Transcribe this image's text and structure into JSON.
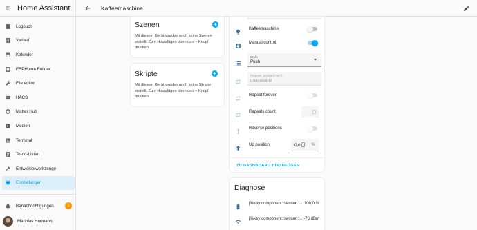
{
  "app": {
    "title": "Home Assistant"
  },
  "sidebar": {
    "items": [
      {
        "label": "Logbuch",
        "icon": "logbook-icon"
      },
      {
        "label": "Verlauf",
        "icon": "history-icon"
      },
      {
        "label": "Kalender",
        "icon": "calendar-icon"
      },
      {
        "label": "ESPHome Builder",
        "icon": "esphome-icon"
      },
      {
        "label": "File editor",
        "icon": "wrench-icon"
      },
      {
        "label": "HACS",
        "icon": "hacs-icon"
      },
      {
        "label": "Matter Hub",
        "icon": "matter-icon"
      },
      {
        "label": "Medien",
        "icon": "media-icon"
      },
      {
        "label": "Terminal",
        "icon": "terminal-icon"
      },
      {
        "label": "To-do-Listen",
        "icon": "todo-icon"
      },
      {
        "label": "Entwicklerwerkzeuge",
        "icon": "hammer-icon"
      },
      {
        "label": "Einstellungen",
        "icon": "gear-icon",
        "active": true
      }
    ],
    "notifications": {
      "label": "Benachrichtigungen",
      "count": "1"
    },
    "user": {
      "name": "Matthias Hormann"
    }
  },
  "header": {
    "title": "Kaffeemaschine"
  },
  "scenes_card": {
    "title": "Szenen",
    "text": "Mit diesem Gerät wurden noch keine Szenen erstellt. Zum Hinzufügen oben den + Knopf drücken."
  },
  "scripts_card": {
    "title": "Skripte",
    "text": "Mit diesem Gerät wurden noch keine Skripte erstellt. Zum Hinzufügen oben den + Knopf drücken."
  },
  "controls": {
    "kaffeemaschine": {
      "label": "Kaffeemaschine",
      "state": "off"
    },
    "manual_control": {
      "label": "Manual control",
      "state": "on"
    },
    "mode": {
      "label": "Mode",
      "value": "Push"
    },
    "program": {
      "label": "Program_position[\"mm\"]...",
      "value": "unavailable"
    },
    "repeat_forever": {
      "label": "Repeat forever",
      "state": "off"
    },
    "repeats_count": {
      "label": "Repeats count"
    },
    "reverse_positions": {
      "label": "Reverse positions",
      "state": "off"
    },
    "up_position": {
      "label": "Up position",
      "value": "0.0",
      "unit": "%"
    },
    "add_to_dashboard": "ZU DASHBOARD HINZUFÜGEN"
  },
  "diagnose": {
    "title": "Diagnose",
    "rows": [
      {
        "label": "[%key:component::sensor::...",
        "value": "100,0 %"
      },
      {
        "label": "[%key:component::sensor::...",
        "value": "-76 dBm"
      }
    ]
  },
  "colors": {
    "accent": "#03a9f4",
    "icon": "#44739e",
    "badge": "#ff9800"
  }
}
